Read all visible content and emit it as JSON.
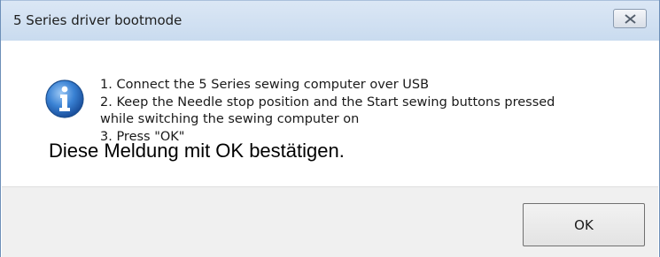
{
  "window": {
    "title": "5 Series driver bootmode"
  },
  "message": {
    "icon": "info-icon",
    "lines": [
      "1. Connect the 5 Series sewing computer over USB",
      "2. Keep the Needle stop position and the Start sewing buttons pressed",
      "while switching the sewing computer on",
      "3. Press \"OK\""
    ]
  },
  "overlay": {
    "text": "Diese Meldung mit OK bestätigen."
  },
  "buttons": {
    "ok_label": "OK",
    "close_icon": "close-icon"
  },
  "colors": {
    "titlebar": "#c9dbef",
    "footer": "#f0f0f0",
    "info_icon": "#2a6fc4"
  }
}
